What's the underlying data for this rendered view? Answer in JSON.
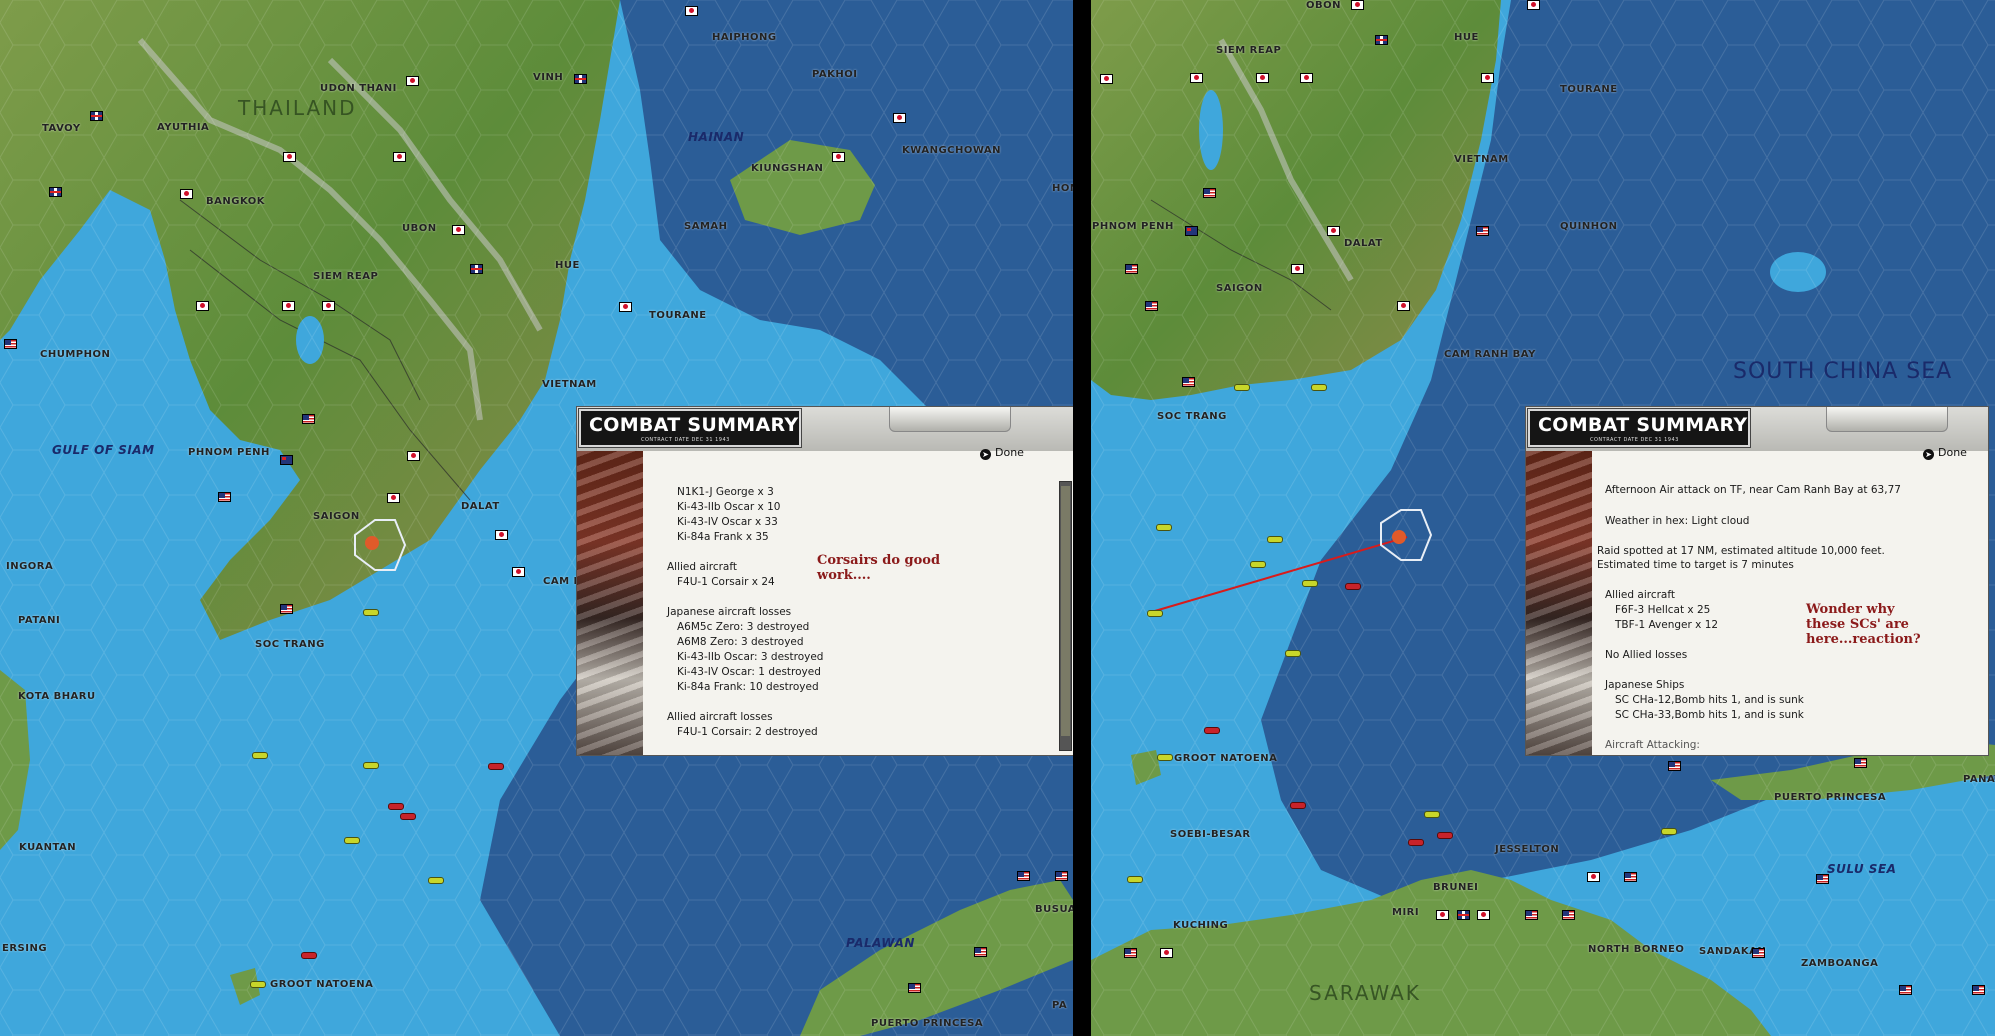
{
  "left_map": {
    "sea_labels": [
      "GULF OF SIAM",
      "HAINAN",
      "PALAWAN"
    ],
    "region_labels": [
      "THAILAND"
    ],
    "place_labels": [
      "HAIPHONG",
      "PAKHOI",
      "TAVOY",
      "AYUTHIA",
      "UDON THANI",
      "VINH",
      "KWANGCHOWAN",
      "KIUNGSHAN",
      "BANGKOK",
      "UBON",
      "SAMAH",
      "HON",
      "SIEM REAP",
      "HUE",
      "CHUMPHON",
      "TOURANE",
      "VIETNAM",
      "PHNOM PENH",
      "SAIGON",
      "DALAT",
      "INGORA",
      "CAM R",
      "PATANI",
      "SOC TRANG",
      "KOTA BHARU",
      "KUANTAN",
      "BUSUA",
      "ERSING",
      "GROOT NATOENA",
      "PUERTO PRINCESA",
      "PA"
    ]
  },
  "right_map": {
    "sea_labels": [
      "SOUTH CHINA SEA",
      "SULU SEA"
    ],
    "region_labels": [
      "SARAWAK"
    ],
    "place_labels": [
      "OBON",
      "SIEM REAP",
      "HUE",
      "TOURANE",
      "VIETNAM",
      "PHNOM PENH",
      "QUINHON",
      "SAIGON",
      "DALAT",
      "CAM RANH BAY",
      "SOC TRANG",
      "GROOT NATOENA",
      "SOEBI-BESAR",
      "JESSELTON",
      "PUERTO PRINCESA",
      "PANAY",
      "BRUNEI",
      "MIRI",
      "KUCHING",
      "NORTH BORNEO",
      "SANDAKAN",
      "ZAMBOANGA"
    ]
  },
  "summary_left": {
    "title": "COMBAT SUMMARY",
    "subtitle": "CONTRACT DATE DEC 31 1943",
    "done_label": "Done",
    "lines": [
      "N1K1-J George x 3",
      "Ki-43-IIb Oscar x 10",
      "Ki-43-IV Oscar x 33",
      "Ki-84a Frank x 35",
      "Allied aircraft",
      "F4U-1 Corsair x 24",
      "Japanese aircraft losses",
      "A6M5c Zero: 3 destroyed",
      "A6M8 Zero: 3 destroyed",
      "Ki-43-IIb Oscar: 3 destroyed",
      "Ki-43-IV Oscar: 1 destroyed",
      "Ki-84a Frank: 10 destroyed",
      "Allied aircraft losses",
      "F4U-1 Corsair: 2 destroyed"
    ],
    "note": "Corsairs do good work...."
  },
  "summary_right": {
    "title": "COMBAT SUMMARY",
    "subtitle": "CONTRACT DATE DEC 31 1943",
    "done_label": "Done",
    "lines": [
      "Afternoon Air attack on TF, near Cam Ranh Bay at 63,77",
      "Weather in hex: Light cloud",
      "Raid spotted at 17 NM, estimated altitude 10,000 feet.",
      "Estimated time to target is 7 minutes",
      "Allied aircraft",
      "F6F-3 Hellcat x 25",
      "TBF-1 Avenger x 12",
      "No Allied losses",
      "Japanese Ships",
      "SC CHa-12,Bomb hits 1, and is sunk",
      "SC CHa-33,Bomb hits 1, and is sunk",
      "Aircraft Attacking:"
    ],
    "note": "Wonder why these SCs' are here...reaction?"
  },
  "colors": {
    "japan_red": "#d0102a",
    "note_red": "#8b1a1a",
    "sea_shallow": "#3fa7dc",
    "sea_deep": "#2b5d97",
    "land": "#6e9a48"
  }
}
